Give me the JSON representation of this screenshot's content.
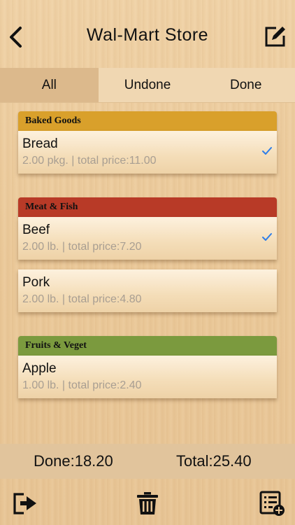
{
  "nav": {
    "title": "Wal-Mart Store",
    "back_icon": "back-chevron-icon",
    "edit_icon": "edit-icon"
  },
  "tabs": [
    {
      "label": "All",
      "active": true
    },
    {
      "label": "Undone",
      "active": false
    },
    {
      "label": "Done",
      "active": false
    }
  ],
  "sections": [
    {
      "name": "Baked  Goods",
      "color": "#d9a02b",
      "items": [
        {
          "name": "Bread",
          "detail": "2.00 pkg. | total price:11.00",
          "done": true
        }
      ]
    },
    {
      "name": "Meat & Fish",
      "color": "#b83a27",
      "items": [
        {
          "name": "Beef",
          "detail": "2.00 lb. | total price:7.20",
          "done": true
        },
        {
          "name": "Pork",
          "detail": "2.00 lb. | total price:4.80",
          "done": false
        }
      ]
    },
    {
      "name": "Fruits & Veget",
      "color": "#7b9a3e",
      "items": [
        {
          "name": "Apple",
          "detail": "1.00 lb. | total price:2.40",
          "done": false
        }
      ]
    }
  ],
  "footer": {
    "done": "Done:18.20",
    "total": "Total:25.40"
  },
  "toolbar": {
    "export_icon": "export-icon",
    "trash_icon": "trash-icon",
    "add_list_icon": "add-list-icon"
  },
  "colors": {
    "check": "#2e7ee8",
    "active_tab": "#dcb98c"
  }
}
